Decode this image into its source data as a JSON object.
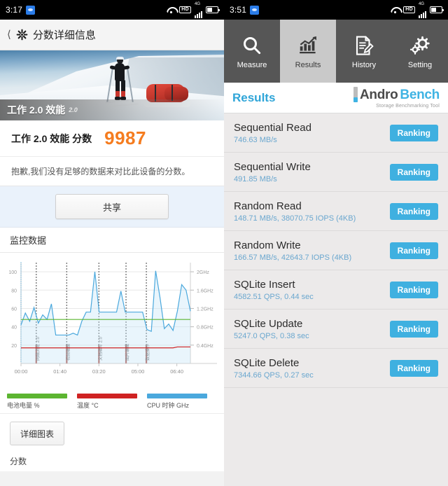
{
  "left": {
    "statusbar": {
      "time": "3:17",
      "badge_icon": "camera-badge-icon",
      "wifi_icon": "wifi-icon",
      "hd_label": "HD",
      "signal_gen": "4G",
      "signal_icon": "signal-bars-icon",
      "battery_icon": "battery-icon"
    },
    "appbar": {
      "back_icon": "back-chevron-icon",
      "app_icon": "pcmark-logo-icon",
      "title": "分数详细信息"
    },
    "hero": {
      "caption_title": "工作 2.0 效能",
      "caption_sub": "2.0"
    },
    "score": {
      "label": "工作 2.0 效能 分数",
      "value": "9987",
      "value_color": "#f57c1f",
      "note": "抱歉,我们没有足够的数据来对比此设备的分数。"
    },
    "share_button": "共享",
    "monitor_section_title": "监控数据",
    "detail_button": "详细图表",
    "score_footer": "分数"
  },
  "chart_data": {
    "type": "line",
    "title": "监控数据",
    "xlabel": "",
    "ylabel": "",
    "grid": true,
    "x_ticks": [
      "00:00",
      "01:40",
      "03:20",
      "05:00",
      "06:40"
    ],
    "y_left_ticks": [
      20,
      40,
      60,
      80,
      100
    ],
    "y_left_range": [
      0,
      110
    ],
    "y_right_ticks": [
      "0.4GHz",
      "0.8GHz",
      "1.2GHz",
      "1.6GHz",
      "2GHz"
    ],
    "y_right_range": [
      0,
      2.2
    ],
    "legend_position": "bottom",
    "legend": [
      {
        "name": "电池电量 %",
        "color": "#5cb531"
      },
      {
        "name": "温度 °C",
        "color": "#cf2222"
      },
      {
        "name": "CPU 时钟 GHz",
        "color": "#4aa8dd"
      }
    ],
    "series": [
      {
        "name": "电池电量 %",
        "color": "#5cb531",
        "values": [
          48,
          48,
          48,
          48,
          48,
          48,
          48,
          48,
          48,
          48,
          48,
          48,
          48,
          48,
          48,
          48,
          48,
          48,
          48,
          48,
          48,
          48,
          48,
          48,
          48,
          48,
          48,
          48,
          48,
          48,
          48,
          48,
          48,
          48,
          48,
          48,
          48,
          48,
          48,
          48
        ]
      },
      {
        "name": "温度 °C",
        "color": "#cf2222",
        "values": [
          17,
          17,
          17,
          17,
          17,
          17,
          17,
          17,
          17,
          17,
          17,
          17,
          17,
          17,
          17,
          17,
          17,
          17,
          17,
          17,
          17,
          17,
          17,
          17,
          17,
          17,
          17,
          17,
          17,
          17,
          17,
          17,
          17,
          17,
          17,
          17,
          18,
          18,
          18,
          18
        ]
      },
      {
        "name": "CPU 时钟 GHz",
        "color": "#4aa8dd",
        "values": [
          42,
          55,
          46,
          61,
          44,
          53,
          48,
          65,
          31,
          31,
          31,
          31,
          33,
          31,
          46,
          56,
          56,
          100,
          56,
          56,
          56,
          56,
          56,
          79,
          56,
          56,
          56,
          56,
          56,
          37,
          35,
          101,
          72,
          38,
          43,
          36,
          57,
          86,
          80,
          57
        ]
      }
    ],
    "markers": [
      {
        "x": "00:10",
        "label": "网络浏览 2.0"
      },
      {
        "x": "01:20",
        "label": "视频编辑"
      },
      {
        "x": "02:45",
        "label": "文档编写 2.0"
      },
      {
        "x": "04:05",
        "label": "图片编辑"
      },
      {
        "x": "04:50",
        "label": "数据操作"
      }
    ]
  },
  "right": {
    "statusbar": {
      "time": "3:51",
      "badge_icon": "camera-badge-icon",
      "wifi_icon": "wifi-icon",
      "hd_label": "HD",
      "signal_gen": "4G",
      "signal_icon": "signal-bars-icon",
      "battery_icon": "battery-icon"
    },
    "tabs": [
      {
        "label": "Measure",
        "icon": "magnifier-icon",
        "active": false
      },
      {
        "label": "Results",
        "icon": "bar-chart-icon",
        "active": true
      },
      {
        "label": "History",
        "icon": "document-pencil-icon",
        "active": false
      },
      {
        "label": "Setting",
        "icon": "gears-icon",
        "active": false
      }
    ],
    "header": {
      "title": "Results",
      "logo_a": "Andro",
      "logo_b": "Bench",
      "logo_sub": "Storage Benchmarking Tool"
    },
    "ranking_label": "Ranking",
    "accent_color": "#3fb0e0",
    "results": [
      {
        "name": "Sequential Read",
        "value": "746.63 MB/s"
      },
      {
        "name": "Sequential Write",
        "value": "491.85 MB/s"
      },
      {
        "name": "Random Read",
        "value": "148.71 MB/s, 38070.75 IOPS (4KB)"
      },
      {
        "name": "Random Write",
        "value": "166.57 MB/s, 42643.7 IOPS (4KB)"
      },
      {
        "name": "SQLite Insert",
        "value": "4582.51 QPS, 0.44 sec"
      },
      {
        "name": "SQLite Update",
        "value": "5247.0 QPS, 0.38 sec"
      },
      {
        "name": "SQLite Delete",
        "value": "7344.66 QPS, 0.27 sec"
      }
    ]
  }
}
